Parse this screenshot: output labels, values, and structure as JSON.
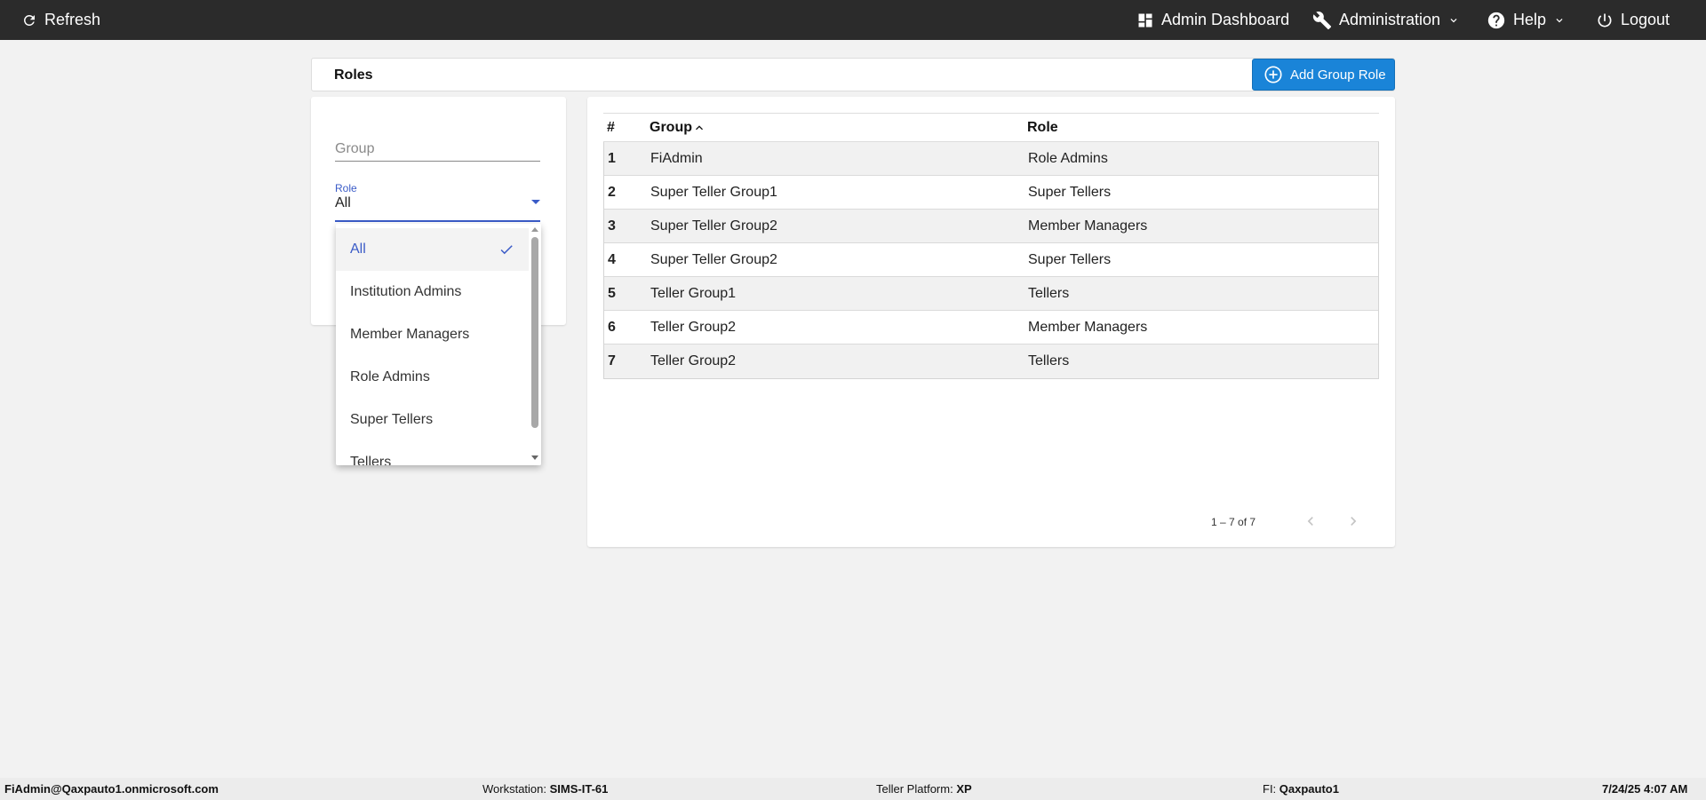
{
  "topbar": {
    "refresh_label": "Refresh",
    "dashboard_label": "Admin Dashboard",
    "administration_label": "Administration",
    "help_label": "Help",
    "logout_label": "Logout"
  },
  "page": {
    "title": "Roles",
    "add_button_label": "Add Group Role"
  },
  "filters": {
    "group_placeholder": "Group",
    "group_value": "",
    "role_label": "Role",
    "role_value": "All",
    "role_options": [
      {
        "label": "All",
        "selected": true
      },
      {
        "label": "Institution Admins",
        "selected": false
      },
      {
        "label": "Member Managers",
        "selected": false
      },
      {
        "label": "Role Admins",
        "selected": false
      },
      {
        "label": "Super Tellers",
        "selected": false
      },
      {
        "label": "Tellers",
        "selected": false
      }
    ]
  },
  "table": {
    "headers": {
      "num": "#",
      "group": "Group",
      "role": "Role"
    },
    "sort": {
      "column": "group",
      "direction": "ascending"
    },
    "rows": [
      {
        "num": "1",
        "group": "FiAdmin",
        "role": "Role Admins"
      },
      {
        "num": "2",
        "group": "Super Teller Group1",
        "role": "Super Tellers"
      },
      {
        "num": "3",
        "group": "Super Teller Group2",
        "role": "Member Managers"
      },
      {
        "num": "4",
        "group": "Super Teller Group2",
        "role": "Super Tellers"
      },
      {
        "num": "5",
        "group": "Teller Group1",
        "role": "Tellers"
      },
      {
        "num": "6",
        "group": "Teller Group2",
        "role": "Member Managers"
      },
      {
        "num": "7",
        "group": "Teller Group2",
        "role": "Tellers"
      }
    ],
    "pagination": {
      "range_text": "1 – 7 of 7"
    }
  },
  "footer": {
    "user": "FiAdmin@Qaxpauto1.onmicrosoft.com",
    "workstation_label": "Workstation:",
    "workstation_value": "SIMS-IT-61",
    "platform_label": "Teller Platform:",
    "platform_value": "XP",
    "fi_label": "FI:",
    "fi_value": "Qaxpauto1",
    "datetime": "7/24/25 4:07 AM"
  },
  "colors": {
    "topbar": "#2b2b2b",
    "accent": "#3a5bc7",
    "primary_button": "#1a84d8",
    "page_bg": "#f2f2f2"
  }
}
